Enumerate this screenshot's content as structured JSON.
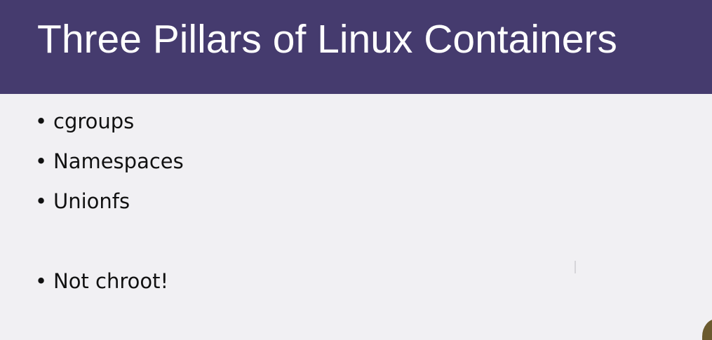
{
  "slide": {
    "title": "Three Pillars of Linux Containers",
    "bullet_glyph": "•",
    "bullets": [
      "cgroups",
      "Namespaces",
      "Unionfs",
      "Not chroot!"
    ]
  },
  "colors": {
    "title_bar": "#453b6e",
    "background": "#f1f0f3",
    "title_text": "#ffffff",
    "body_text": "#111111"
  }
}
